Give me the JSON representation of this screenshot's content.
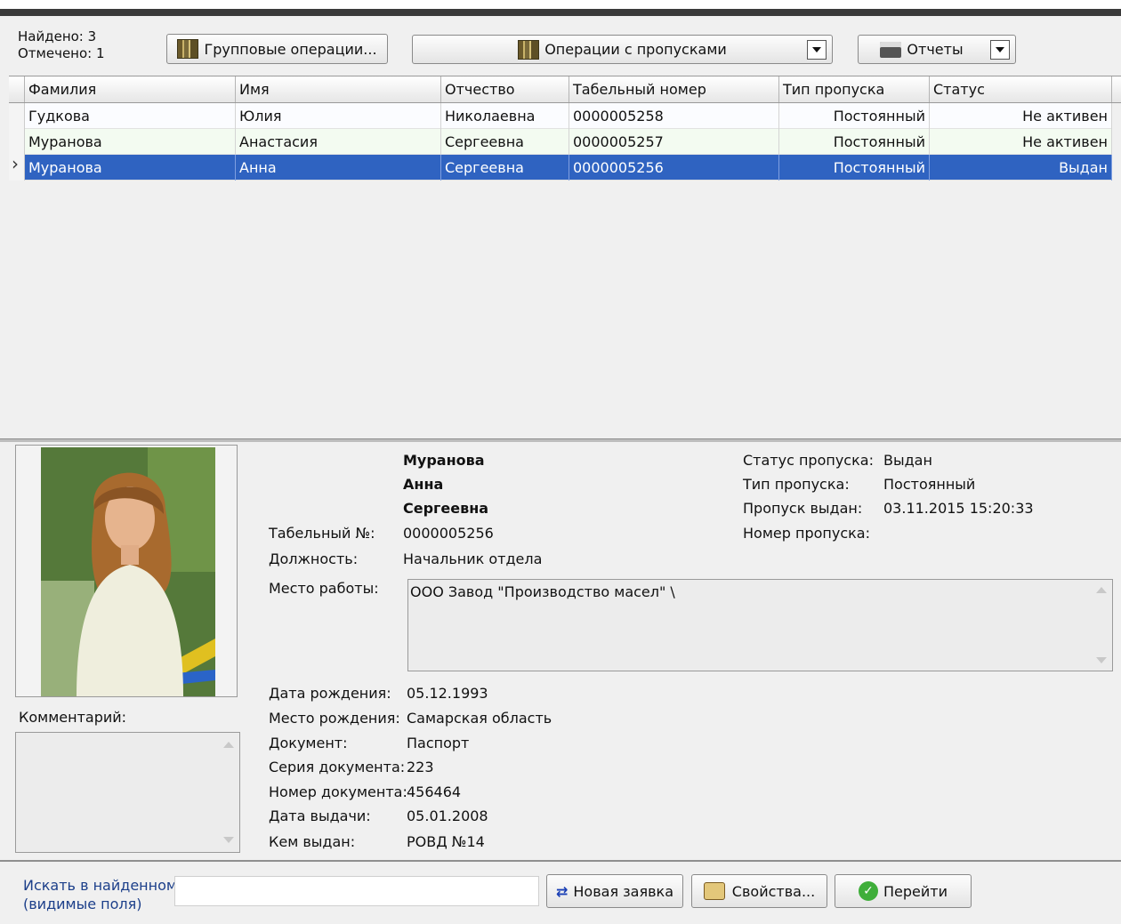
{
  "toolbar": {
    "found_label": "Найдено: 3",
    "checked_label": "Отмечено: 1",
    "group_ops_label": "Групповые операции...",
    "pass_ops_label": "Операции с пропусками",
    "reports_label": "Отчеты"
  },
  "grid": {
    "columns": [
      "Фамилия",
      "Имя",
      "Отчество",
      "Табельный номер",
      "Тип пропуска",
      "Статус"
    ],
    "rows": [
      {
        "last": "Гудкова",
        "first": "Юлия",
        "middle": "Николаевна",
        "tab": "0000005258",
        "type": "Постоянный",
        "status": "Не активен",
        "selected": false
      },
      {
        "last": "Муранова",
        "first": "Анастасия",
        "middle": "Сергеевна",
        "tab": "0000005257",
        "type": "Постоянный",
        "status": "Не активен",
        "selected": false
      },
      {
        "last": "Муранова",
        "first": "Анна",
        "middle": "Сергеевна",
        "tab": "0000005256",
        "type": "Постоянный",
        "status": "Выдан",
        "selected": true
      }
    ]
  },
  "detail": {
    "last_name": "Муранова",
    "first_name": "Анна",
    "middle_name": "Сергеевна",
    "tab_label": "Табельный №:",
    "tab_value": "0000005256",
    "position_label": "Должность:",
    "position_value": "Начальник отдела",
    "workplace_label": "Место работы:",
    "workplace_value": "ООО Завод \"Производство масел\" \\",
    "birth_date_label": "Дата рождения:",
    "birth_date_value": "05.12.1993",
    "birth_place_label": "Место рождения:",
    "birth_place_value": "Самарская область",
    "document_label": "Документ:",
    "document_value": "Паспорт",
    "series_label": "Серия документа:",
    "series_value": "223",
    "number_label": "Номер документа:",
    "number_value": "456464",
    "issue_date_label": "Дата выдачи:",
    "issue_date_value": "05.01.2008",
    "issued_by_label": "Кем выдан:",
    "issued_by_value": "РОВД №14",
    "pass_status_label": "Статус пропуска:",
    "pass_status_value": "Выдан",
    "pass_type_label": "Тип пропуска:",
    "pass_type_value": "Постоянный",
    "pass_issued_label": "Пропуск выдан:",
    "pass_issued_value": "03.11.2015 15:20:33",
    "pass_number_label": "Номер пропуска:",
    "comment_label": "Комментарий:"
  },
  "footer": {
    "search_label_1": "Искать в найденном",
    "search_label_2": "(видимые поля)",
    "search_value": "",
    "new_request_label": "Новая заявка",
    "properties_label": "Свойства...",
    "go_label": "Перейти"
  }
}
